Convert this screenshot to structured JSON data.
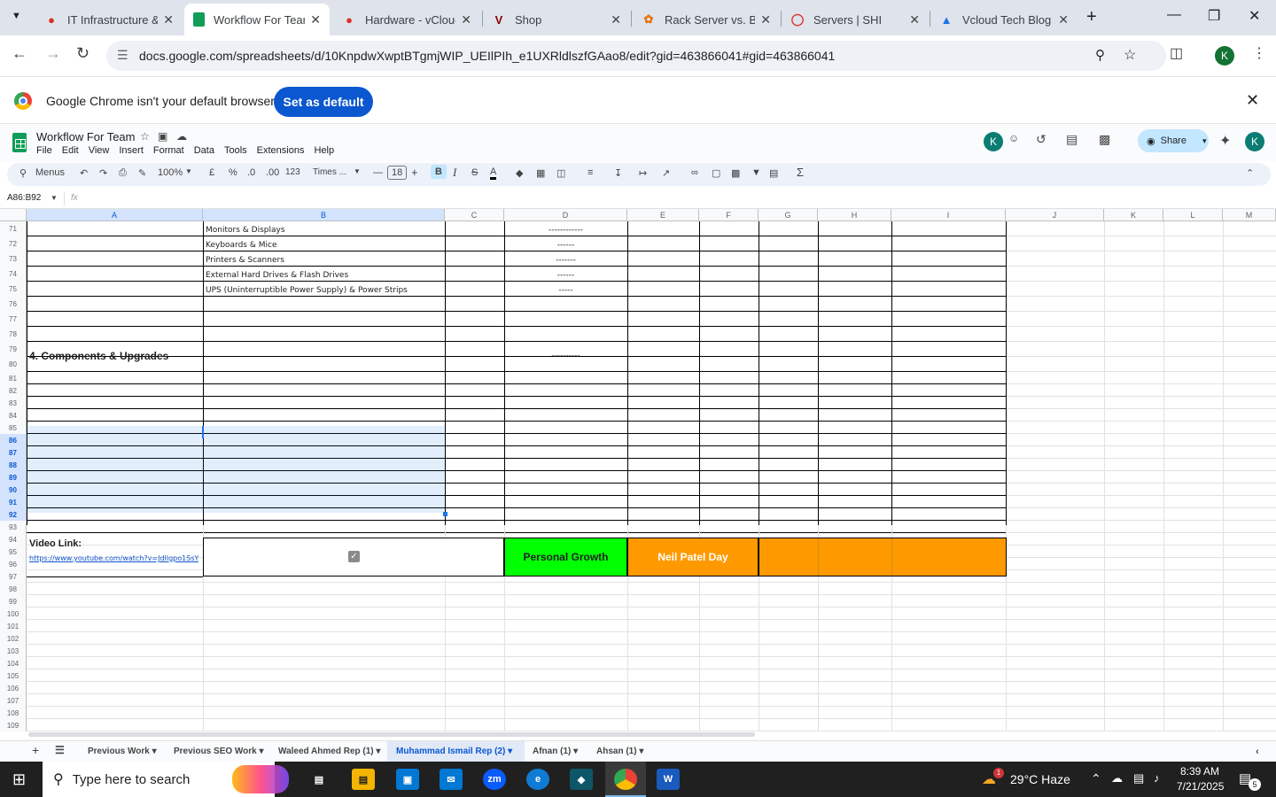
{
  "browser": {
    "tabs": [
      {
        "title": "IT Infrastructure &",
        "icon": "red"
      },
      {
        "title": "Workflow For Tean",
        "icon": "sheets",
        "active": true
      },
      {
        "title": "Hardware - vCloud",
        "icon": "red"
      },
      {
        "title": "Shop",
        "icon": "v"
      },
      {
        "title": "Rack Server vs. Bla",
        "icon": "orange"
      },
      {
        "title": "Servers | SHI",
        "icon": "circle"
      },
      {
        "title": "Vcloud Tech Blog",
        "icon": "drive"
      }
    ],
    "url": "docs.google.com/spreadsheets/d/10KnpdwXwptBTgmjWIP_UEIlPIh_e1UXRldlszfGAao8/edit?gid=463866041#gid=463866041",
    "profile_initial": "K"
  },
  "infobar": {
    "message": "Google Chrome isn't your default browser",
    "button": "Set as default"
  },
  "sheet": {
    "title": "Workflow For Team",
    "menus": [
      "File",
      "Edit",
      "View",
      "Insert",
      "Format",
      "Data",
      "Tools",
      "Extensions",
      "Help"
    ],
    "share_label": "Share",
    "user_initial": "K"
  },
  "toolbar": {
    "menus_label": "Menus",
    "zoom": "100%",
    "currency": "£",
    "percent": "%",
    "dec_dec": ".0",
    "dec_inc": ".00",
    "format_num": "123",
    "font": "Times ...",
    "font_size": "18"
  },
  "formula": {
    "name_box": "A86:B92",
    "fx": "fx"
  },
  "grid": {
    "columns": [
      "A",
      "B",
      "C",
      "D",
      "E",
      "F",
      "G",
      "H",
      "I",
      "J",
      "K",
      "L",
      "M"
    ],
    "rows": [
      "71",
      "72",
      "73",
      "74",
      "75",
      "76",
      "77",
      "78",
      "79",
      "80",
      "81",
      "82",
      "83",
      "84",
      "85",
      "86",
      "87",
      "88",
      "89",
      "90",
      "91",
      "92",
      "93",
      "94",
      "95",
      "96",
      "97",
      "98",
      "99",
      "100",
      "101",
      "102",
      "103",
      "104",
      "105",
      "106",
      "107",
      "108",
      "109"
    ],
    "cells": {
      "b71": "Monitors & Displays",
      "b72": "Keyboards & Mice",
      "b73": "Printers & Scanners",
      "b74": "External Hard Drives & Flash Drives",
      "b75": "UPS (Uninterruptible Power Supply) & Power Strips",
      "d71": "------------",
      "d72": "------",
      "d73": "-------",
      "d74": "------",
      "d75": "-----",
      "a80": "4. Components & Upgrades",
      "d80": "----------",
      "a95": "Video Link:",
      "a96": "https://www.youtube.com/watch?v=JdIlgpo1SsY",
      "d95": "Personal Growth",
      "e95": "Neil Patel Day"
    },
    "colors": {
      "green": "#00ff00",
      "orange": "#ff9900"
    }
  },
  "sheet_tabs": [
    "Previous Work",
    "Previous SEO Work",
    "Waleed Ahmed Rep (1)",
    "Muhammad Ismail Rep (2)",
    "Afnan (1)",
    "Ahsan (1)"
  ],
  "active_sheet_tab": "Muhammad Ismail Rep (2)",
  "taskbar": {
    "search_placeholder": "Type here to search",
    "weather": "29°C  Haze",
    "time": "8:39 AM",
    "date": "7/21/2025",
    "notification_count": "5",
    "weather_badge": "1"
  }
}
